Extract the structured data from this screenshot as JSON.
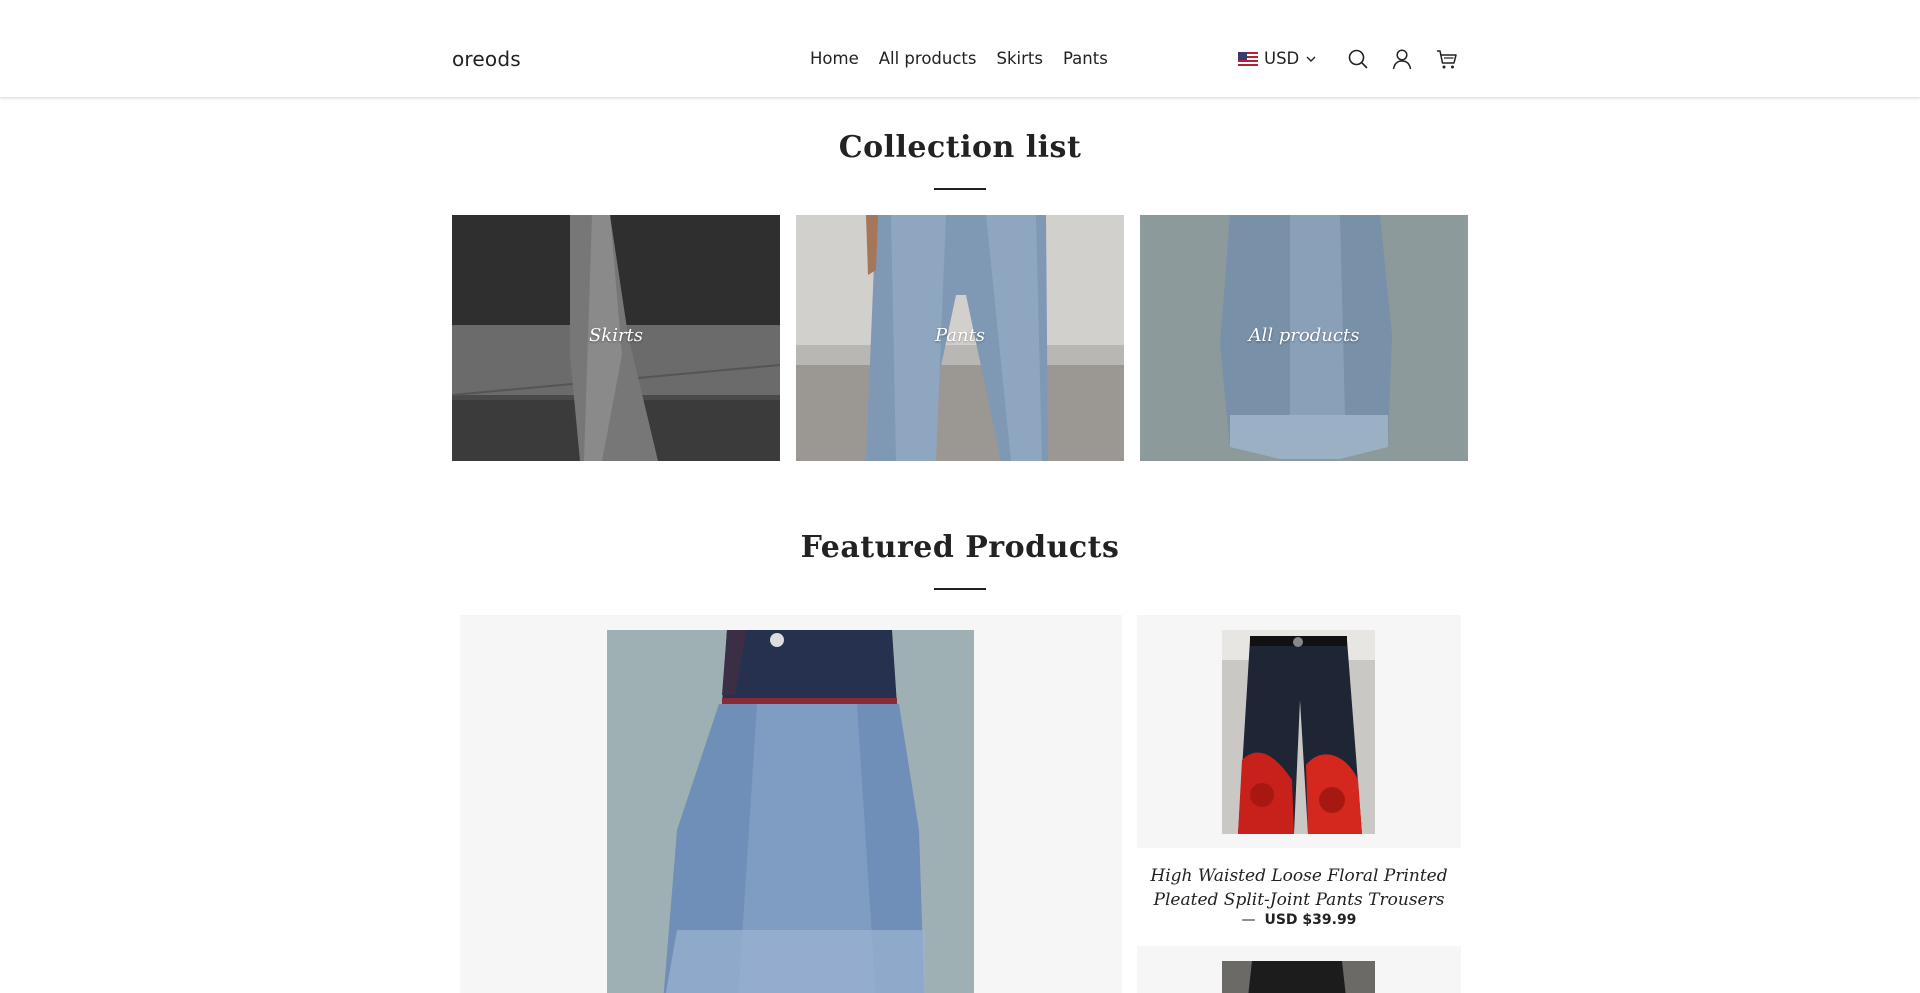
{
  "header": {
    "logo": "oreods",
    "nav": [
      {
        "label": "Home"
      },
      {
        "label": "All products"
      },
      {
        "label": "Skirts"
      },
      {
        "label": "Pants"
      }
    ],
    "currency": "USD",
    "icons": [
      "search-icon",
      "account-icon",
      "cart-icon"
    ]
  },
  "collection": {
    "title": "Collection list",
    "items": [
      {
        "label": "Skirts"
      },
      {
        "label": "Pants"
      },
      {
        "label": "All products"
      }
    ]
  },
  "featured": {
    "title": "Featured Products",
    "products": [
      {
        "title": "High Waisted Loose Floral Printed Pleated Split-Joint Pants Trousers",
        "dash": "—",
        "price": "USD $39.99"
      }
    ]
  },
  "colors": {
    "accent": "#222222",
    "card_bg": "#f6f6f6"
  }
}
